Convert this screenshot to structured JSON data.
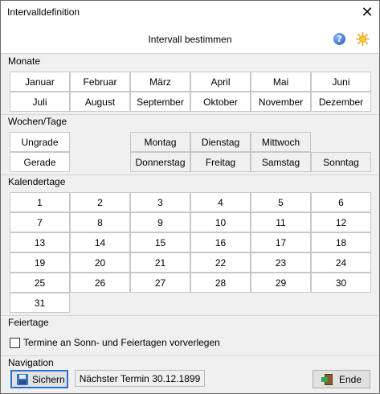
{
  "window": {
    "title": "Intervalldefinition",
    "close_glyph": "✕"
  },
  "header": {
    "title": "Intervall bestimmen",
    "help_glyph": "?"
  },
  "sections": {
    "monate": "Monate",
    "wochen": "Wochen/Tage",
    "kalender": "Kalendertage",
    "feiertage": "Feiertage",
    "navigation": "Navigation"
  },
  "months": [
    "Januar",
    "Februar",
    "März",
    "April",
    "Mai",
    "Juni",
    "Juli",
    "August",
    "September",
    "Oktober",
    "November",
    "Dezember"
  ],
  "week_parity": [
    "Ungrade",
    "Gerade"
  ],
  "weekdays_row1": [
    "Montag",
    "Dienstag",
    "Mittwoch"
  ],
  "weekdays_row2": [
    "Donnerstag",
    "Freitag",
    "Samstag",
    "Sonntag"
  ],
  "days": [
    "1",
    "2",
    "3",
    "4",
    "5",
    "6",
    "7",
    "8",
    "9",
    "10",
    "11",
    "12",
    "13",
    "14",
    "15",
    "16",
    "17",
    "18",
    "19",
    "20",
    "21",
    "22",
    "23",
    "24",
    "25",
    "26",
    "27",
    "28",
    "29",
    "30",
    "31"
  ],
  "holiday_checkbox": {
    "label": "Termine an Sonn- und Feiertagen vorverlegen",
    "checked": false
  },
  "navigation": {
    "save_label": "Sichern",
    "next_date_text": "Nächster Termin 30.12.1899",
    "end_label": "Ende"
  },
  "icons": {
    "help": "help-icon",
    "settings": "sun-icon",
    "save": "floppy-disk-icon",
    "exit": "exit-door-icon"
  }
}
